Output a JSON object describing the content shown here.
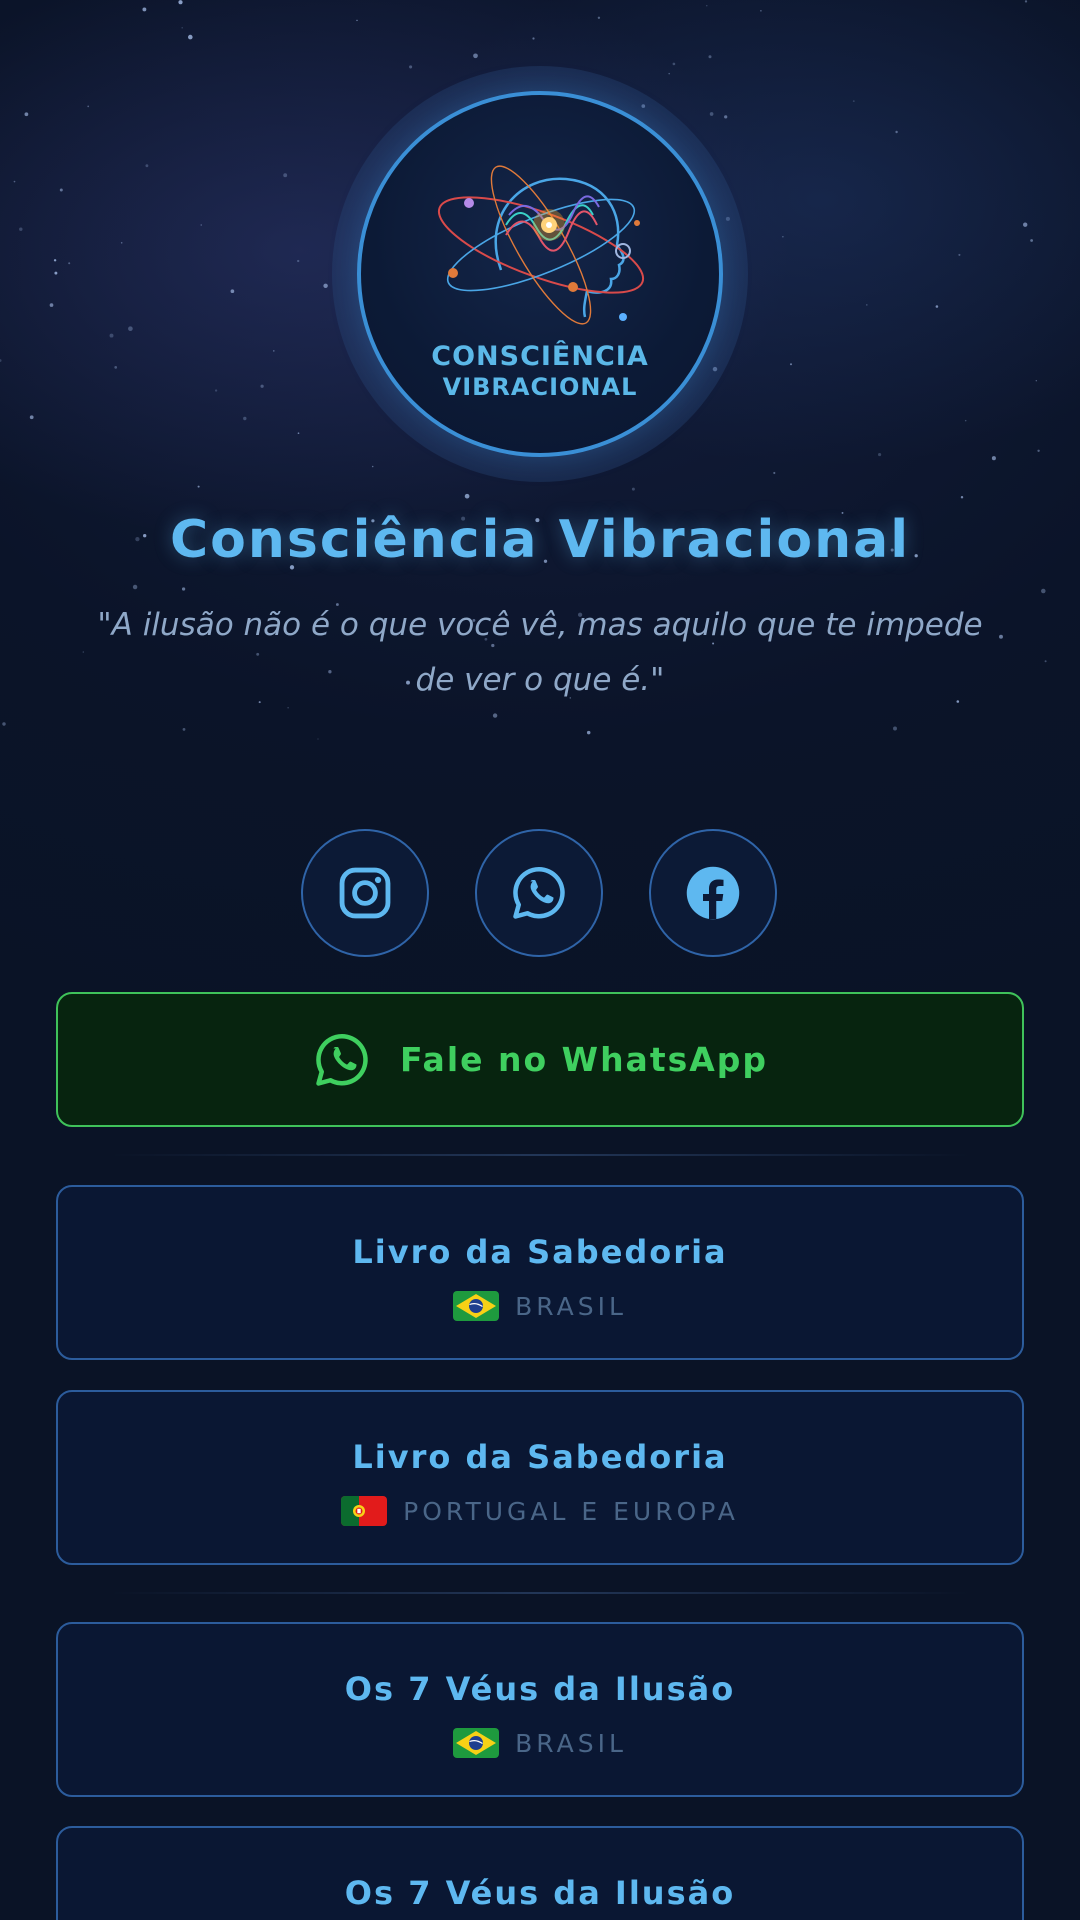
{
  "logo": {
    "line1": "CONSCIÊNCIA",
    "line2": "VIBRACIONAL"
  },
  "profile": {
    "title": "Consciência Vibracional",
    "quote": "\"A ilusão não é o que você vê, mas aquilo que te impede de ver o que é.\""
  },
  "social": [
    {
      "icon": "instagram-icon"
    },
    {
      "icon": "whatsapp-icon"
    },
    {
      "icon": "facebook-icon"
    }
  ],
  "whatsapp_button": {
    "label": "Fale no WhatsApp",
    "icon": "whatsapp-icon",
    "color": "#3fcf5f"
  },
  "links": [
    {
      "title": "Livro da Sabedoria",
      "region": "BRASIL",
      "flag": "brazil-flag-icon"
    },
    {
      "title": "Livro da Sabedoria",
      "region": "PORTUGAL E EUROPA",
      "flag": "portugal-flag-icon"
    },
    {
      "title": "Os 7 Véus da Ilusão",
      "region": "BRASIL",
      "flag": "brazil-flag-icon"
    },
    {
      "title": "Os 7 Véus da Ilusão",
      "region": "",
      "flag": ""
    }
  ],
  "colors": {
    "accent": "#5eb8f0",
    "background": "#0a1428",
    "card_border": "#2c5c9c",
    "whatsapp_green": "#3fcf5f"
  }
}
